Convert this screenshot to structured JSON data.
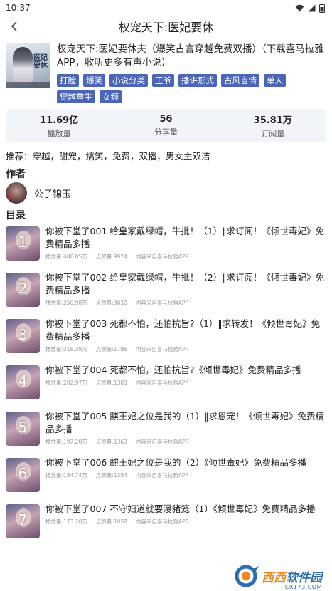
{
  "status_bar": {
    "time": "10:37"
  },
  "header": {
    "title": "权宠天下:医妃要休"
  },
  "album": {
    "cover_text": "医妃要休",
    "description": "权宠天下:医妃要休夫（爆笑古言穿越免费双播）（下载喜马拉雅APP，收听更多有声小说）",
    "tags": [
      "打脸",
      "爆笑",
      "小说分类",
      "王爷",
      "播讲形式",
      "古风言情",
      "单人",
      "穿越重生",
      "女频"
    ]
  },
  "stats": [
    {
      "value": "11.69亿",
      "label": "播放量"
    },
    {
      "value": "56",
      "label": "分享量"
    },
    {
      "value": "35.81万",
      "label": "订阅量"
    }
  ],
  "recommend": "推荐：穿越，甜宠，搞笑，免费，双播，男女主双洁",
  "author_section": {
    "heading": "作者",
    "name": "公子锦玉"
  },
  "catalog_section": {
    "heading": "目录"
  },
  "episodes": [
    {
      "num": "1",
      "title": "你被下堂了001 给皇家戴绿帽，牛批！（1）‖求订阅！《倾世毒妃》免费精品多播",
      "plays": "播放量:408.05万",
      "likes": "点赞量:9974",
      "source": "内容来自喜马拉雅APP"
    },
    {
      "num": "2",
      "title": "你被下堂了002 给皇家戴绿帽，牛批！（2）‖求订阅！《倾世毒妃》免费精品多播",
      "plays": "播放量:250.98万",
      "likes": "点赞量:3032",
      "source": "内容来自喜马拉雅APP"
    },
    {
      "num": "3",
      "title": "你被下堂了003 死都不怕，还怕抗旨?（1）‖求转发！《倾世毒妃》免费精品多播",
      "plays": "播放量:218.38万",
      "likes": "点赞量:1796",
      "source": "内容来自喜马拉雅APP"
    },
    {
      "num": "4",
      "title": "你被下堂了004 死都不怕，还怕抗旨?《倾世毒妃》免费精品多播",
      "plays": "播放量:202.97万",
      "likes": "点赞量:1303",
      "source": "内容来自喜马拉雅APP"
    },
    {
      "num": "5",
      "title": "你被下堂了005 麒王妃之位是我的（1）‖求恩宠！《倾世毒妃》免费精品多播",
      "plays": "播放量:197.20万",
      "likes": "点赞量:1363",
      "source": "内容来自喜马拉雅APP"
    },
    {
      "num": "6",
      "title": "你被下堂了006 麒王妃之位是我的（2）《倾世毒妃》免费精品多播",
      "plays": "播放量:184.74万",
      "likes": "点赞量:1354",
      "source": "内容来自喜马拉雅APP"
    },
    {
      "num": "7",
      "title": "你被下堂了007 不守妇道就要浸猪笼（1）《倾世毒妃》免费精品多播",
      "plays": "播放量:173.20万",
      "likes": "点赞量:1058",
      "source": "内容来自喜马拉雅APP"
    }
  ],
  "watermark": {
    "text_cn": "西西",
    "text_rest": "软件园",
    "url": "CR173.COM"
  },
  "colors": {
    "tag_bg": "#4b66b8",
    "stats_bg": "#f1f4f9",
    "meta_text": "#999999"
  }
}
